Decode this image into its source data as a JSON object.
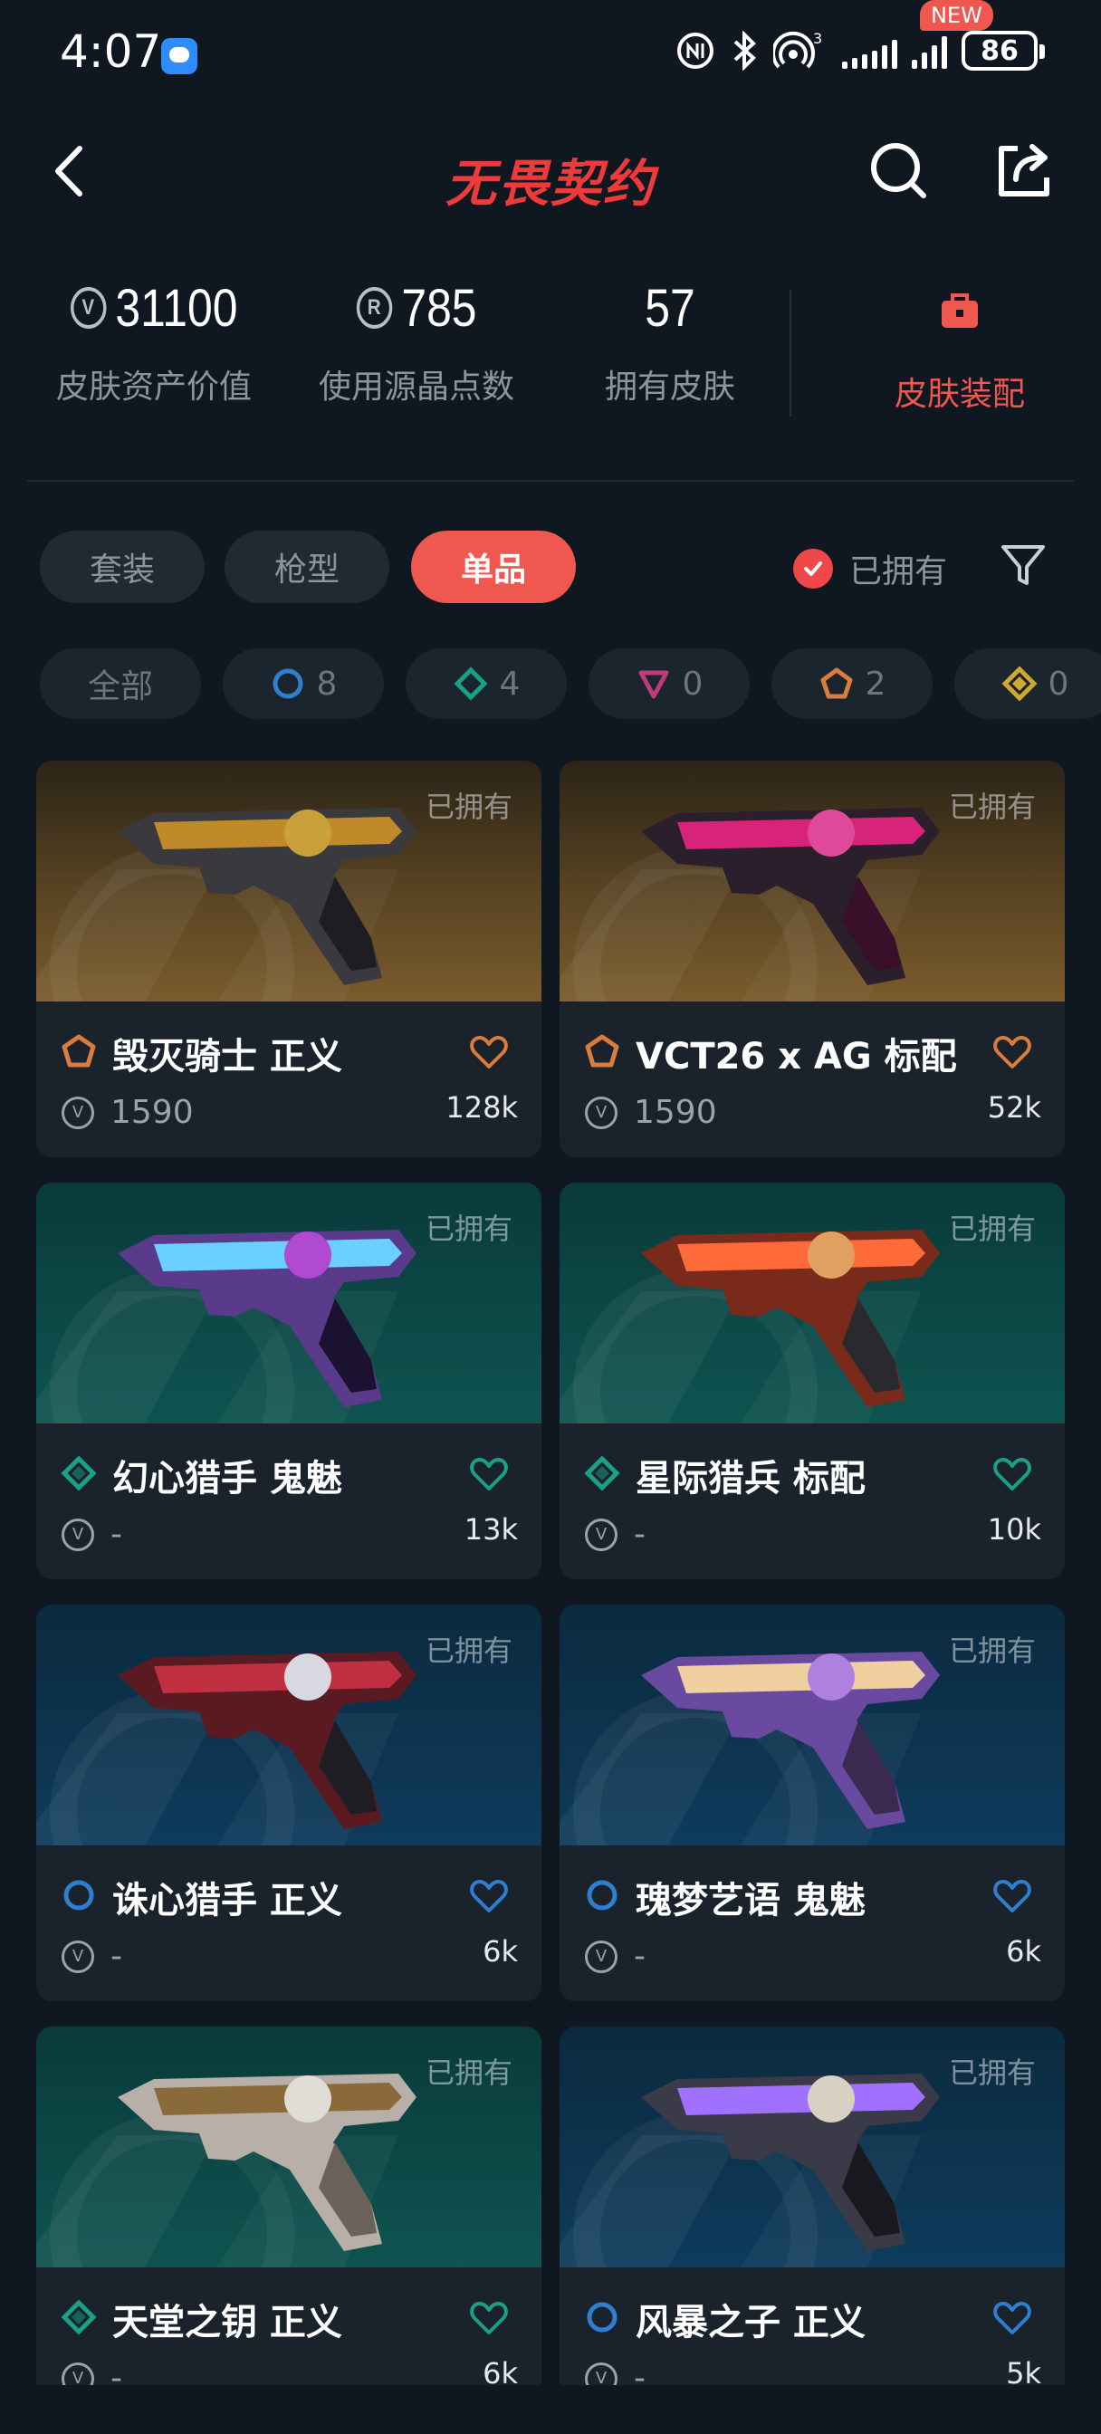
{
  "status_bar": {
    "time": "4:07",
    "battery": "86",
    "icons": [
      "message-icon",
      "nfc-icon",
      "bluetooth-icon",
      "hotspot-icon",
      "signal-icon",
      "signal-icon",
      "battery-icon"
    ]
  },
  "header": {
    "title": "无畏契约",
    "icons": [
      "back-arrow-icon",
      "search-icon",
      "share-icon"
    ]
  },
  "stats": [
    {
      "value": "31100",
      "label": "皮肤资产价值",
      "icon": "valorant-points-icon"
    },
    {
      "value": "785",
      "label": "使用源晶点数",
      "icon": "radianite-icon"
    },
    {
      "value": "57",
      "label": "拥有皮肤"
    }
  ],
  "equip": {
    "badge": "NEW",
    "label": "皮肤装配",
    "icon": "briefcase-icon"
  },
  "tabs": [
    {
      "label": "套装",
      "active": false
    },
    {
      "label": "枪型",
      "active": false
    },
    {
      "label": "单品",
      "active": true
    }
  ],
  "owned_filter": {
    "label": "已拥有",
    "checked": true
  },
  "rarity_filters": [
    {
      "label": "全部"
    },
    {
      "count": "8",
      "tier": "select",
      "color": "#2f7fd0"
    },
    {
      "count": "4",
      "tier": "deluxe",
      "color": "#1aa085"
    },
    {
      "count": "0",
      "tier": "premium",
      "color": "#c03a7a"
    },
    {
      "count": "2",
      "tier": "exclusive",
      "color": "#d97c3e"
    },
    {
      "count": "0",
      "tier": "ultra",
      "color": "#cfa733"
    }
  ],
  "colors": {
    "accent": "#f0574f",
    "background": "#0f1821",
    "card": "#1a232c"
  },
  "skins": [
    {
      "name": "毁灭骑士 正义",
      "price": "1590",
      "likes": "128k",
      "owned": "已拥有",
      "tier": "exclusive",
      "bg": "brown"
    },
    {
      "name": "VCT26 x AG 标配",
      "price": "1590",
      "likes": "52k",
      "owned": "已拥有",
      "tier": "exclusive",
      "bg": "brown"
    },
    {
      "name": "幻心猎手 鬼魅",
      "price": "-",
      "likes": "13k",
      "owned": "已拥有",
      "tier": "deluxe",
      "bg": "teal"
    },
    {
      "name": "星际猎兵 标配",
      "price": "-",
      "likes": "10k",
      "owned": "已拥有",
      "tier": "deluxe",
      "bg": "teal"
    },
    {
      "name": "诛心猎手 正义",
      "price": "-",
      "likes": "6k",
      "owned": "已拥有",
      "tier": "select",
      "bg": "blue"
    },
    {
      "name": "瑰梦艺语 鬼魅",
      "price": "-",
      "likes": "6k",
      "owned": "已拥有",
      "tier": "select",
      "bg": "blue"
    },
    {
      "name": "天堂之钥 正义",
      "price": "-",
      "likes": "6k",
      "owned": "已拥有",
      "tier": "deluxe",
      "bg": "teal"
    },
    {
      "name": "风暴之子 正义",
      "price": "-",
      "likes": "5k",
      "owned": "已拥有",
      "tier": "select",
      "bg": "blue"
    }
  ]
}
